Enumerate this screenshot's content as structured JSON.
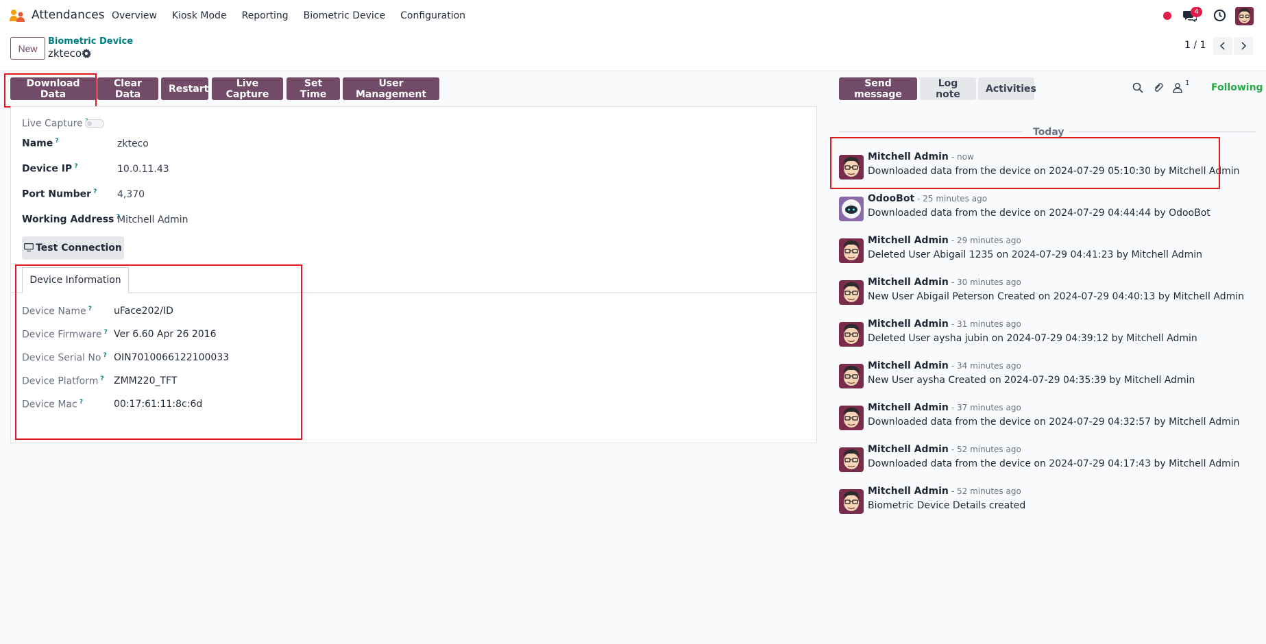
{
  "nav": {
    "app_name": "Attendances",
    "menu": [
      "Overview",
      "Kiosk Mode",
      "Reporting",
      "Biometric Device",
      "Configuration"
    ],
    "chat_badge": "4"
  },
  "control_panel": {
    "new_label": "New",
    "breadcrumb_parent": "Biometric Device",
    "breadcrumb_current": "zkteco",
    "pager": "1 / 1"
  },
  "actions": [
    "Download Data",
    "Clear Data",
    "Restart",
    "Live Capture",
    "Set Time",
    "User Management"
  ],
  "form": {
    "live_capture_label": "Live Capture",
    "fields": [
      {
        "label": "Name",
        "value": "zkteco"
      },
      {
        "label": "Device IP",
        "value": "10.0.11.43"
      },
      {
        "label": "Port Number",
        "value": "4,370"
      },
      {
        "label": "Working Address",
        "value": "Mitchell Admin"
      }
    ],
    "test_button": "Test Connection",
    "tab": "Device Information",
    "device": [
      {
        "label": "Device Name",
        "value": "uFace202/ID"
      },
      {
        "label": "Device Firmware",
        "value": "Ver 6.60 Apr 26 2016"
      },
      {
        "label": "Device Serial No",
        "value": "OIN7010066122100033"
      },
      {
        "label": "Device Platform",
        "value": "ZMM220_TFT"
      },
      {
        "label": "Device Mac",
        "value": "00:17:61:11:8c:6d"
      }
    ]
  },
  "chatter": {
    "send_message": "Send message",
    "log_note": "Log note",
    "activities": "Activities",
    "followers_count": "1",
    "following": "Following",
    "today": "Today",
    "messages": [
      {
        "author": "Mitchell Admin",
        "time": "- now",
        "body": "Downloaded data from the device on 2024-07-29 05:10:30 by Mitchell Admin",
        "avatar": "mitchell"
      },
      {
        "author": "OdooBot",
        "time": "- 25 minutes ago",
        "body": "Downloaded data from the device on 2024-07-29 04:44:44 by OdooBot",
        "avatar": "odoobot"
      },
      {
        "author": "Mitchell Admin",
        "time": "- 29 minutes ago",
        "body": "Deleted User Abigail 1235 on 2024-07-29 04:41:23 by Mitchell Admin",
        "avatar": "mitchell"
      },
      {
        "author": "Mitchell Admin",
        "time": "- 30 minutes ago",
        "body": "New User Abigail Peterson Created on 2024-07-29 04:40:13 by Mitchell Admin",
        "avatar": "mitchell"
      },
      {
        "author": "Mitchell Admin",
        "time": "- 31 minutes ago",
        "body": "Deleted User aysha jubin on 2024-07-29 04:39:12 by Mitchell Admin",
        "avatar": "mitchell"
      },
      {
        "author": "Mitchell Admin",
        "time": "- 34 minutes ago",
        "body": "New User aysha Created on 2024-07-29 04:35:39 by Mitchell Admin",
        "avatar": "mitchell"
      },
      {
        "author": "Mitchell Admin",
        "time": "- 37 minutes ago",
        "body": "Downloaded data from the device on 2024-07-29 04:32:57 by Mitchell Admin",
        "avatar": "mitchell"
      },
      {
        "author": "Mitchell Admin",
        "time": "- 52 minutes ago",
        "body": "Downloaded data from the device on 2024-07-29 04:17:43 by Mitchell Admin",
        "avatar": "mitchell"
      },
      {
        "author": "Mitchell Admin",
        "time": "- 52 minutes ago",
        "body": "Biometric Device Details created",
        "avatar": "mitchell"
      }
    ]
  },
  "colors": {
    "brand": "#714b67",
    "link": "#017e84",
    "following": "#28a745",
    "highlight": "#e3181e"
  }
}
